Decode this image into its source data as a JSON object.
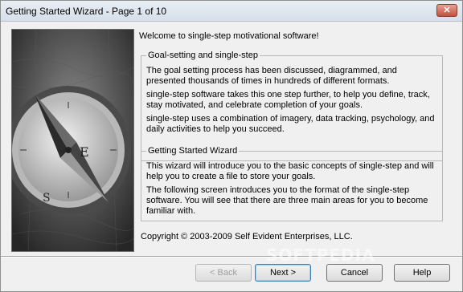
{
  "window": {
    "title": "Getting Started Wizard - Page 1 of 10",
    "close_label": "✕"
  },
  "welcome": "Welcome to single-step motivational software!",
  "goal_group": {
    "title": "Goal-setting and single-step",
    "paragraphs": [
      "The goal setting process has been discussed, diagrammed, and presented thousands of times in hundreds of different formats.",
      "single-step software takes this one step further, to help you define, track, stay motivated, and celebrate completion of your goals.",
      "single-step uses a combination of imagery, data tracking, psychology, and daily activities to help you succeed."
    ]
  },
  "wizard_group": {
    "title": "Getting Started Wizard",
    "paragraphs": [
      "This wizard will introduce you to the basic concepts of single-step and will help you to create a file to store your goals.",
      "The following screen introduces you to the format of the single-step software. You will see that there are three main areas for you to become familiar with."
    ]
  },
  "copyright": "Copyright © 2003-2009 Self Evident Enterprises, LLC.",
  "buttons": {
    "back": "< Back",
    "next": "Next >",
    "cancel": "Cancel",
    "help": "Help"
  },
  "image": {
    "icon": "compass-on-map-image"
  },
  "watermark": "SOFTPEDIA"
}
